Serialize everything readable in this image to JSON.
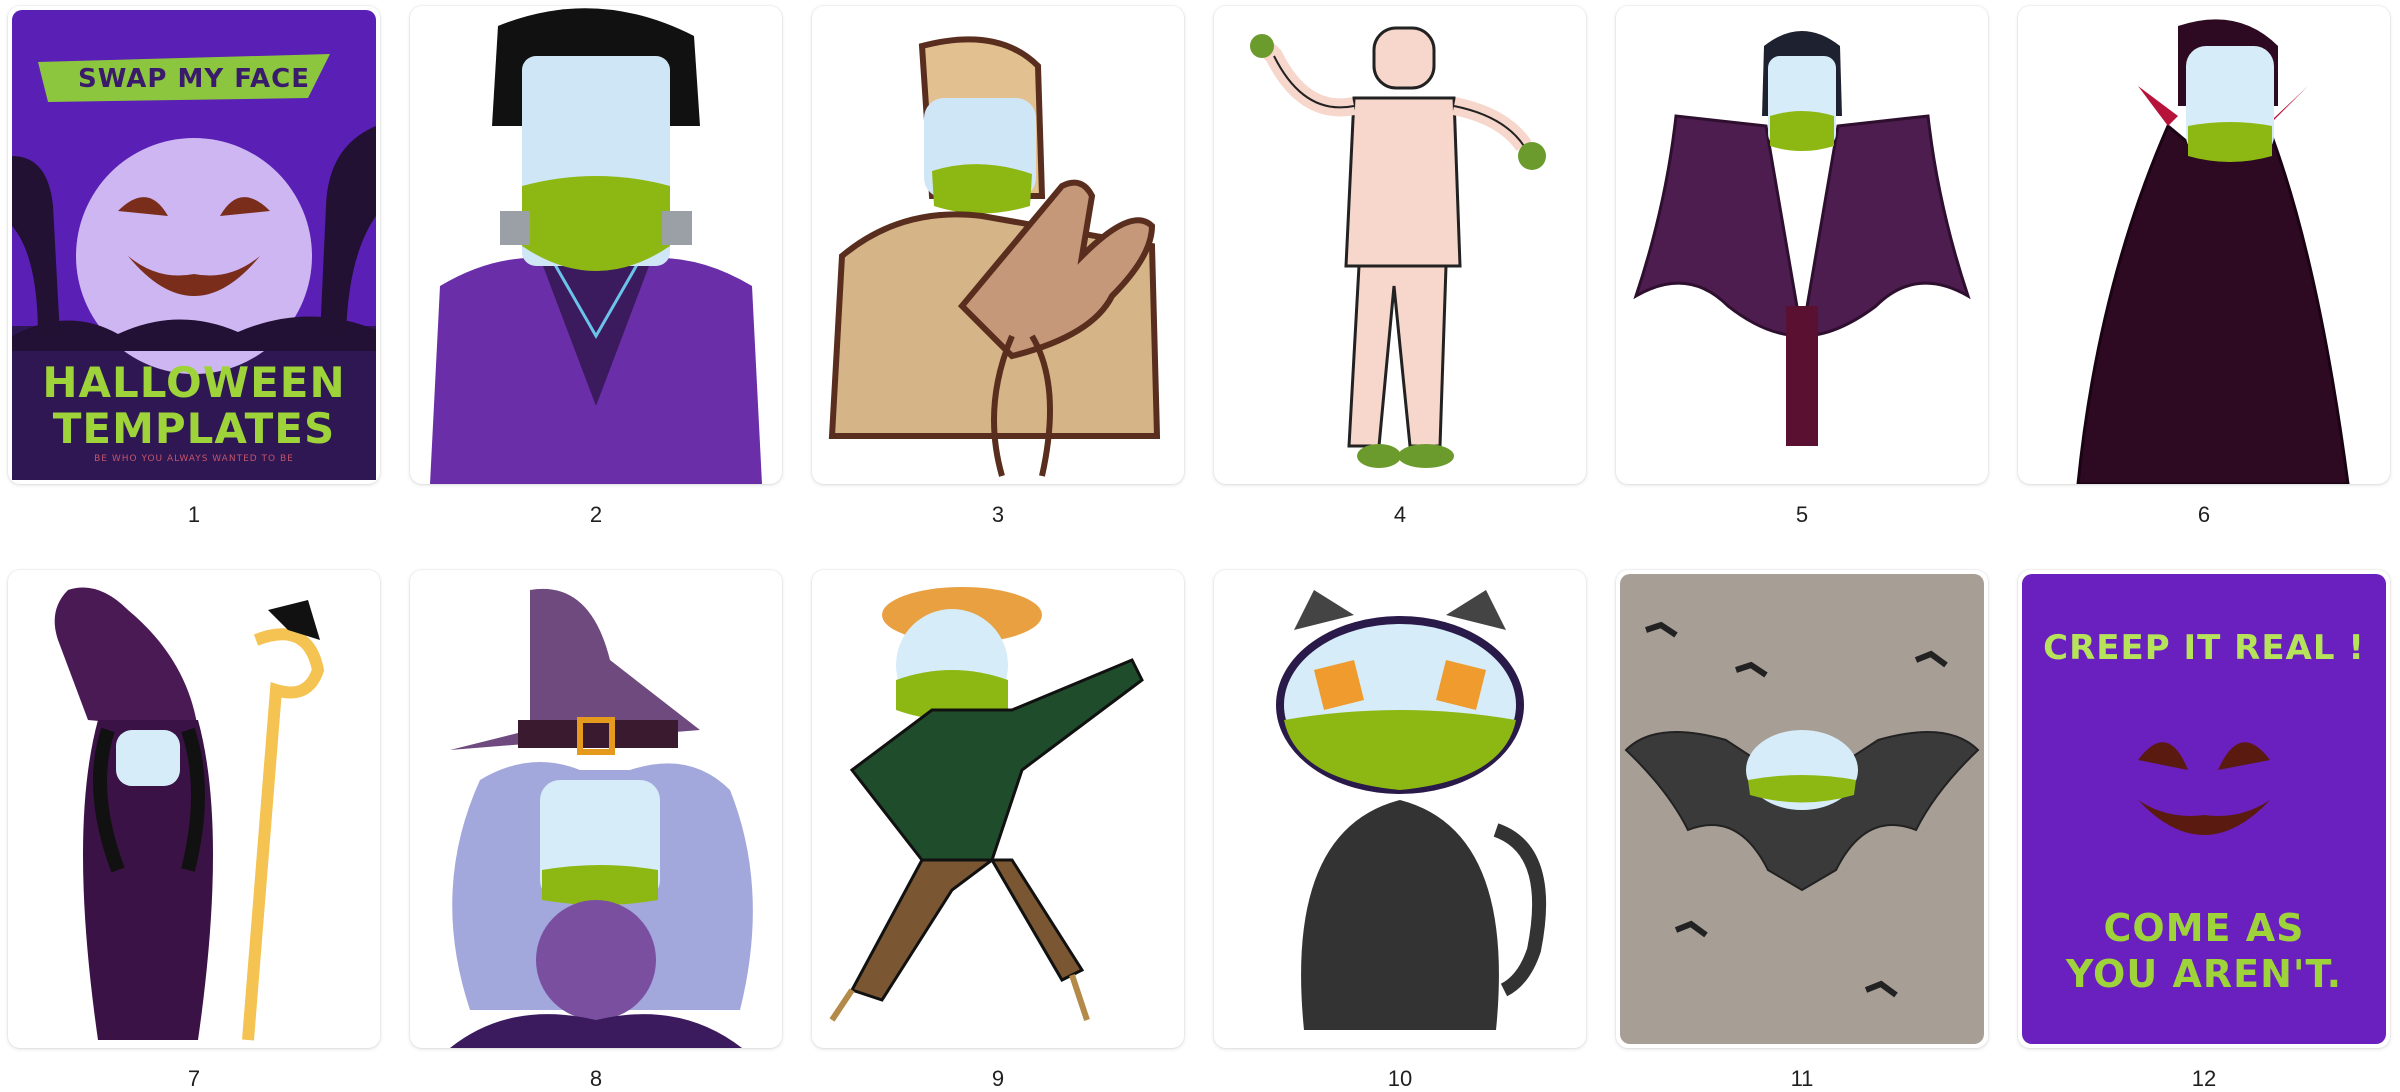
{
  "colors": {
    "purple": "#5a1fb5",
    "dark_purple": "#2a1a4a",
    "lime": "#8cc63f",
    "orange": "#e8a33a",
    "bat_gray": "#a79e96"
  },
  "pages": [
    {
      "number": "1",
      "title": "SWAP MY FACE",
      "headline_line1": "HALLOWEEN",
      "headline_line2": "TEMPLATES",
      "tagline": "BE WHO YOU ALWAYS WANTED TO BE"
    },
    {
      "number": "2"
    },
    {
      "number": "3"
    },
    {
      "number": "4"
    },
    {
      "number": "5"
    },
    {
      "number": "6"
    },
    {
      "number": "7"
    },
    {
      "number": "8"
    },
    {
      "number": "9"
    },
    {
      "number": "10"
    },
    {
      "number": "11"
    },
    {
      "number": "12",
      "headline": "CREEP IT REAL !",
      "footer_line1": "COME AS",
      "footer_line2": "YOU AREN'T."
    }
  ]
}
